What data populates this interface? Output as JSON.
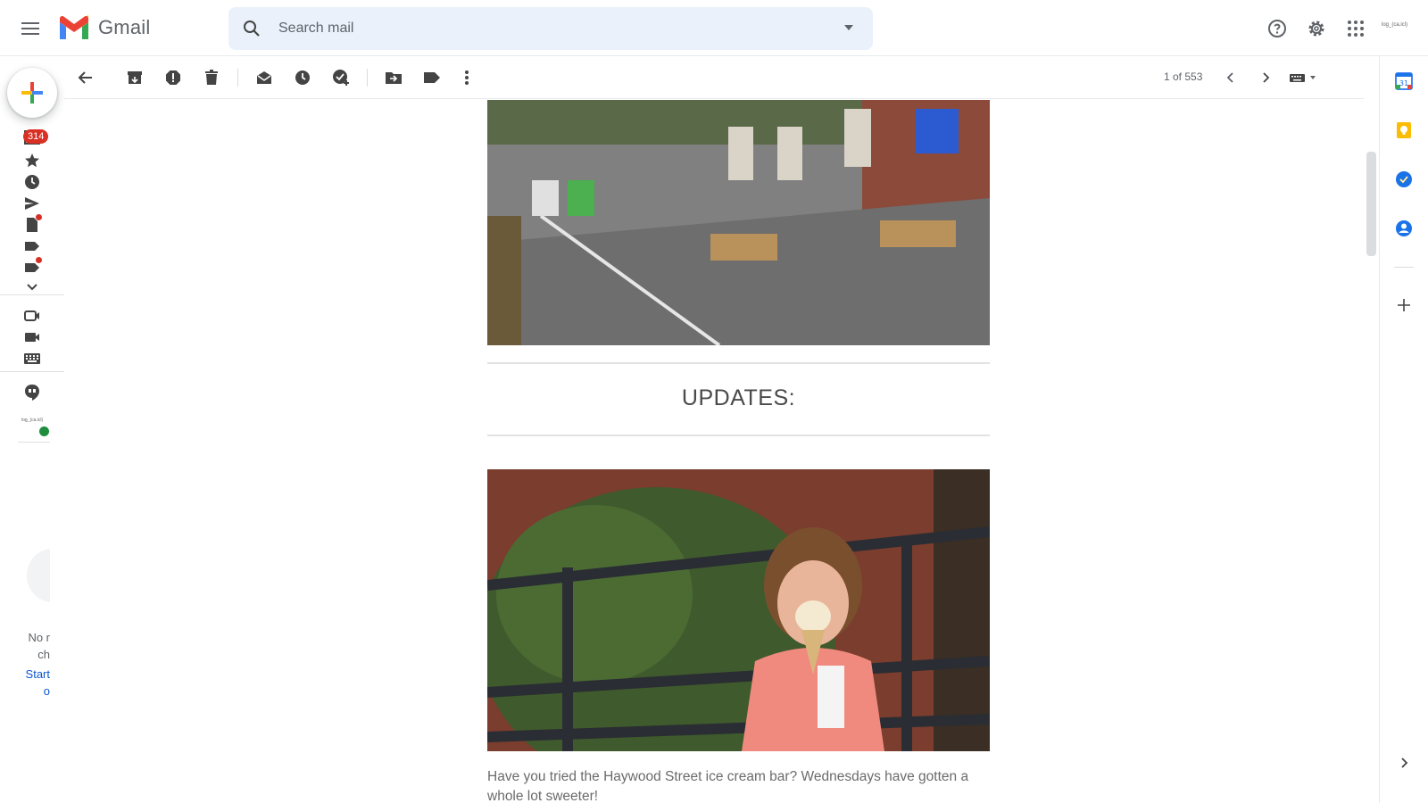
{
  "app": {
    "name": "Gmail",
    "account_label": "log_(ca.icl)"
  },
  "search": {
    "placeholder": "Search mail"
  },
  "nav": {
    "inbox_count": "314",
    "chat_user": "log_(ca.icl)"
  },
  "chat_panel": {
    "empty_line1": "No r",
    "empty_line2": "ch",
    "start_line1": "Start",
    "start_line2": "o"
  },
  "toolbar": {
    "pager": "1 of 553"
  },
  "email": {
    "heading": "UPDATES:",
    "paragraph": "Have you tried the Haywood Street ice cream bar? Wednesdays have gotten a whole lot sweeter!"
  },
  "colors": {
    "accent_blue": "#0b57d0",
    "badge_red": "#d93025",
    "online_green": "#1e8e3e",
    "search_bg": "#eaf1fb"
  }
}
